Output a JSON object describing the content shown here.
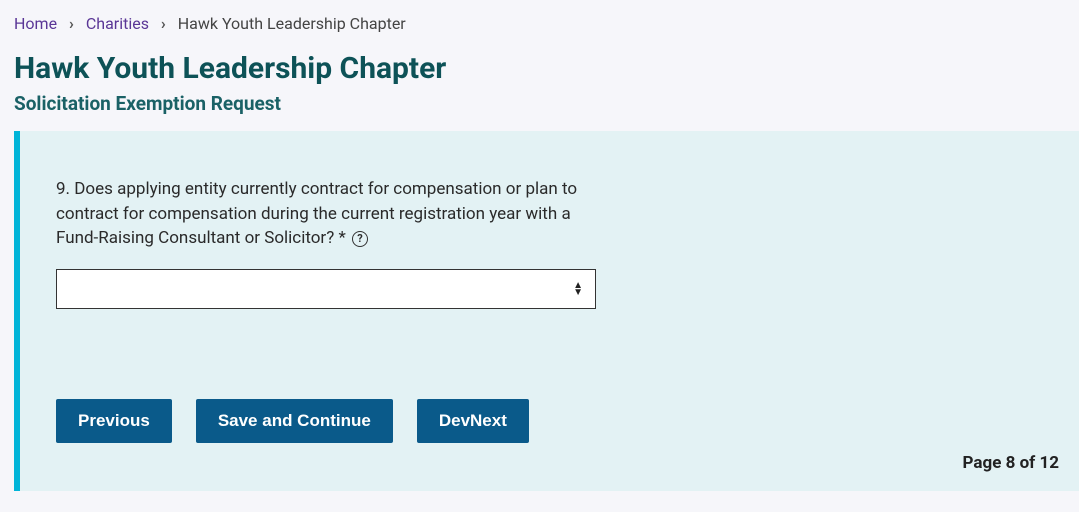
{
  "breadcrumb": {
    "home": "Home",
    "charities": "Charities",
    "current": "Hawk Youth Leadership Chapter"
  },
  "title": "Hawk Youth Leadership Chapter",
  "subtitle": "Solicitation Exemption Request",
  "question": {
    "text": "9. Does applying entity currently contract for compensation or plan to contract for compensation during the current registration year with a Fund-Raising Consultant or Solicitor? *",
    "selected": ""
  },
  "buttons": {
    "previous": "Previous",
    "save": "Save and Continue",
    "devnext": "DevNext"
  },
  "pager": "Page 8 of 12"
}
